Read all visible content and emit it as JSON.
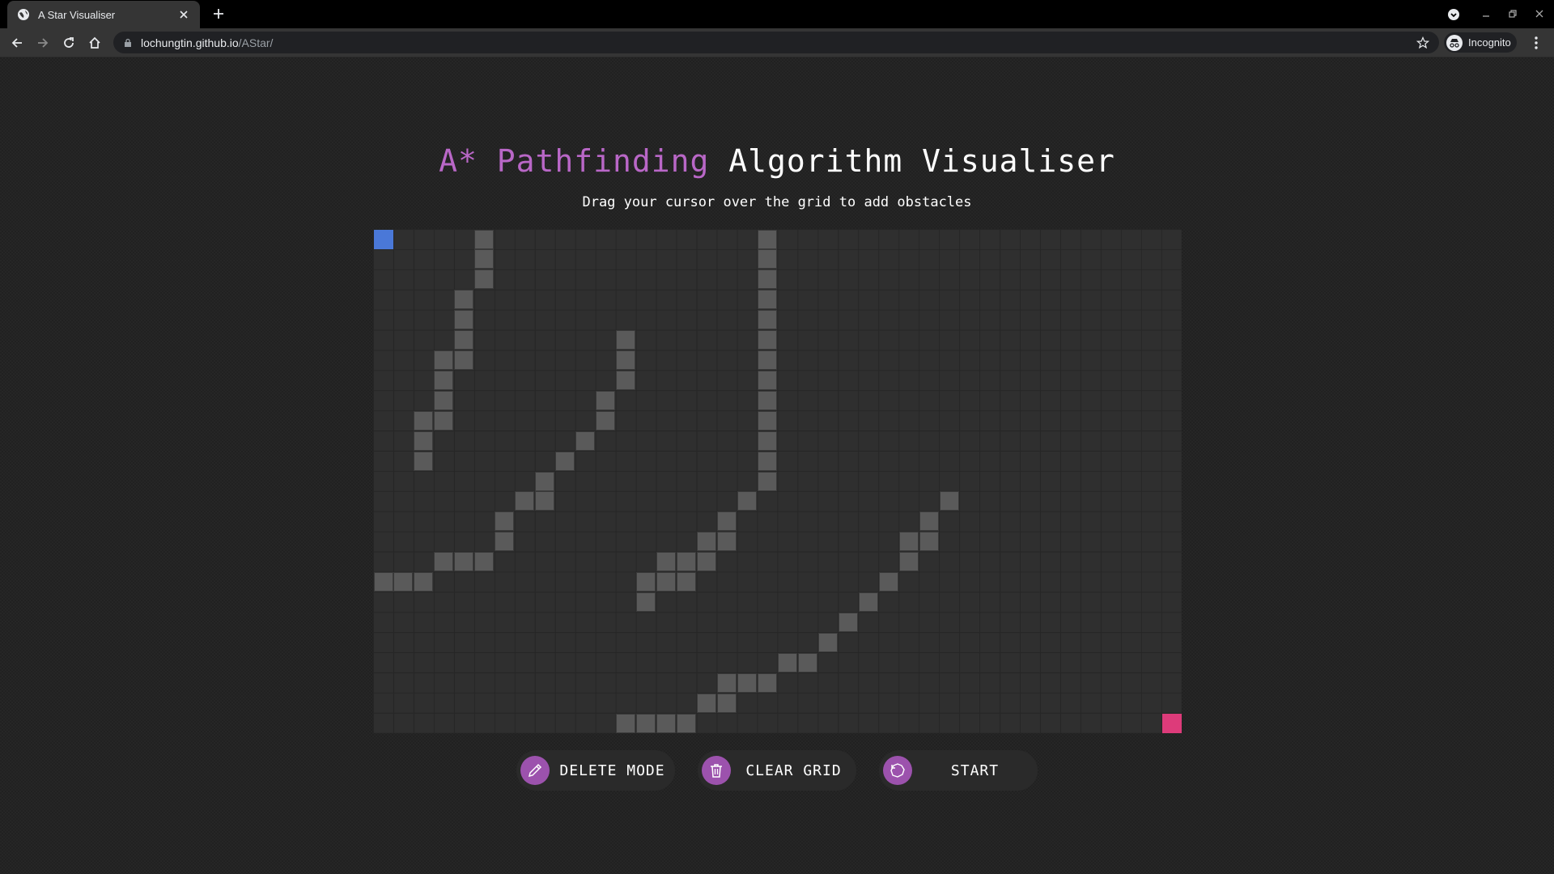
{
  "browser": {
    "tab_title": "A Star Visualiser",
    "url_host": "lochungtin.github.io",
    "url_path": "/AStar/",
    "incognito_label": "Incognito"
  },
  "page": {
    "title_accent": "A* Pathfinding",
    "title_rest": " Algorithm Visualiser",
    "subtitle": "Drag your cursor over the grid to add obstacles"
  },
  "grid": {
    "cols": 40,
    "rows": 25,
    "start": [
      0,
      0
    ],
    "end": [
      39,
      24
    ],
    "walls": [
      [
        5,
        0
      ],
      [
        5,
        1
      ],
      [
        5,
        2
      ],
      [
        4,
        3
      ],
      [
        4,
        4
      ],
      [
        4,
        5
      ],
      [
        3,
        6
      ],
      [
        4,
        6
      ],
      [
        3,
        7
      ],
      [
        3,
        8
      ],
      [
        2,
        9
      ],
      [
        3,
        9
      ],
      [
        2,
        10
      ],
      [
        2,
        11
      ],
      [
        12,
        5
      ],
      [
        12,
        6
      ],
      [
        12,
        7
      ],
      [
        11,
        8
      ],
      [
        11,
        9
      ],
      [
        10,
        10
      ],
      [
        9,
        11
      ],
      [
        8,
        12
      ],
      [
        7,
        13
      ],
      [
        8,
        13
      ],
      [
        6,
        14
      ],
      [
        6,
        15
      ],
      [
        3,
        16
      ],
      [
        4,
        16
      ],
      [
        5,
        16
      ],
      [
        0,
        17
      ],
      [
        1,
        17
      ],
      [
        2,
        17
      ],
      [
        19,
        0
      ],
      [
        19,
        1
      ],
      [
        19,
        2
      ],
      [
        19,
        3
      ],
      [
        19,
        4
      ],
      [
        19,
        5
      ],
      [
        19,
        6
      ],
      [
        19,
        7
      ],
      [
        19,
        8
      ],
      [
        19,
        9
      ],
      [
        19,
        10
      ],
      [
        19,
        11
      ],
      [
        19,
        12
      ],
      [
        18,
        13
      ],
      [
        17,
        14
      ],
      [
        16,
        15
      ],
      [
        17,
        15
      ],
      [
        14,
        16
      ],
      [
        15,
        16
      ],
      [
        16,
        16
      ],
      [
        13,
        17
      ],
      [
        14,
        17
      ],
      [
        15,
        17
      ],
      [
        13,
        18
      ],
      [
        28,
        13
      ],
      [
        27,
        14
      ],
      [
        26,
        15
      ],
      [
        27,
        15
      ],
      [
        26,
        16
      ],
      [
        25,
        17
      ],
      [
        24,
        18
      ],
      [
        23,
        19
      ],
      [
        22,
        20
      ],
      [
        20,
        21
      ],
      [
        21,
        21
      ],
      [
        17,
        22
      ],
      [
        18,
        22
      ],
      [
        19,
        22
      ],
      [
        16,
        23
      ],
      [
        17,
        23
      ],
      [
        12,
        24
      ],
      [
        13,
        24
      ],
      [
        14,
        24
      ],
      [
        15,
        24
      ]
    ]
  },
  "controls": {
    "delete_label": "DELETE MODE",
    "clear_label": "CLEAR GRID",
    "start_label": "START"
  },
  "colors": {
    "accent": "#b967c7",
    "button_circle": "#9c52ad",
    "start_node": "#4a78d8",
    "end_node": "#dd3b7a",
    "wall": "#5a5a5a"
  }
}
